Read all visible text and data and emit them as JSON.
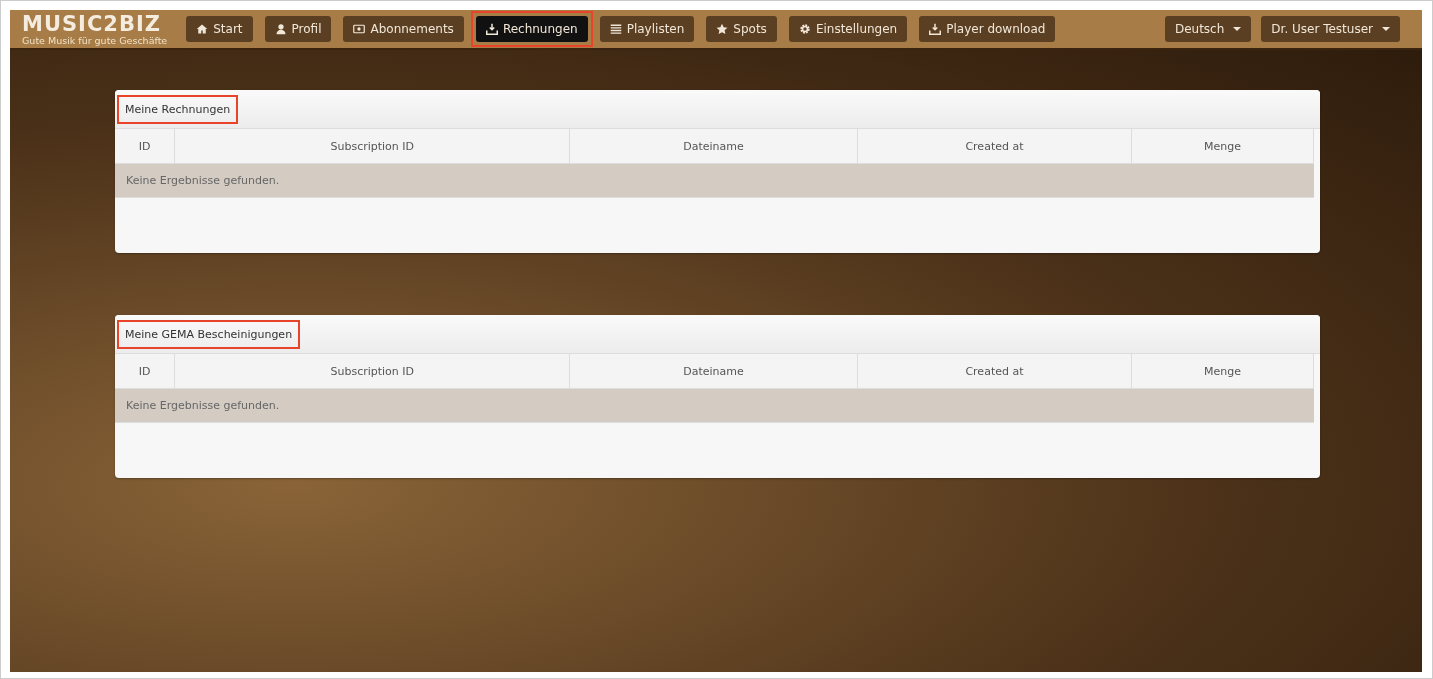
{
  "brand": {
    "logo": "MUSIC2BIZ",
    "tagline": "Gute Musik für gute Geschäfte"
  },
  "nav": [
    {
      "label": "Start",
      "selected": false,
      "highlighted": false
    },
    {
      "label": "Profil",
      "selected": false,
      "highlighted": false
    },
    {
      "label": "Abonnements",
      "selected": false,
      "highlighted": false
    },
    {
      "label": "Rechnungen",
      "selected": true,
      "highlighted": true
    },
    {
      "label": "Playlisten",
      "selected": false,
      "highlighted": false
    },
    {
      "label": "Spots",
      "selected": false,
      "highlighted": false
    },
    {
      "label": "Einstellungen",
      "selected": false,
      "highlighted": false
    },
    {
      "label": "Player download",
      "selected": false,
      "highlighted": false
    }
  ],
  "nav_right": [
    {
      "label": "Deutsch"
    },
    {
      "label": "Dr. User Testuser"
    }
  ],
  "panels": [
    {
      "title": "Meine Rechnungen",
      "highlighted": true,
      "columns": [
        "ID",
        "Subscription ID",
        "Dateiname",
        "Created at",
        "Menge"
      ],
      "empty_message": "Keine Ergebnisse gefunden."
    },
    {
      "title": "Meine GEMA Bescheinigungen",
      "highlighted": true,
      "columns": [
        "ID",
        "Subscription ID",
        "Dateiname",
        "Created at",
        "Menge"
      ],
      "empty_message": "Keine Ergebnisse gefunden."
    }
  ]
}
